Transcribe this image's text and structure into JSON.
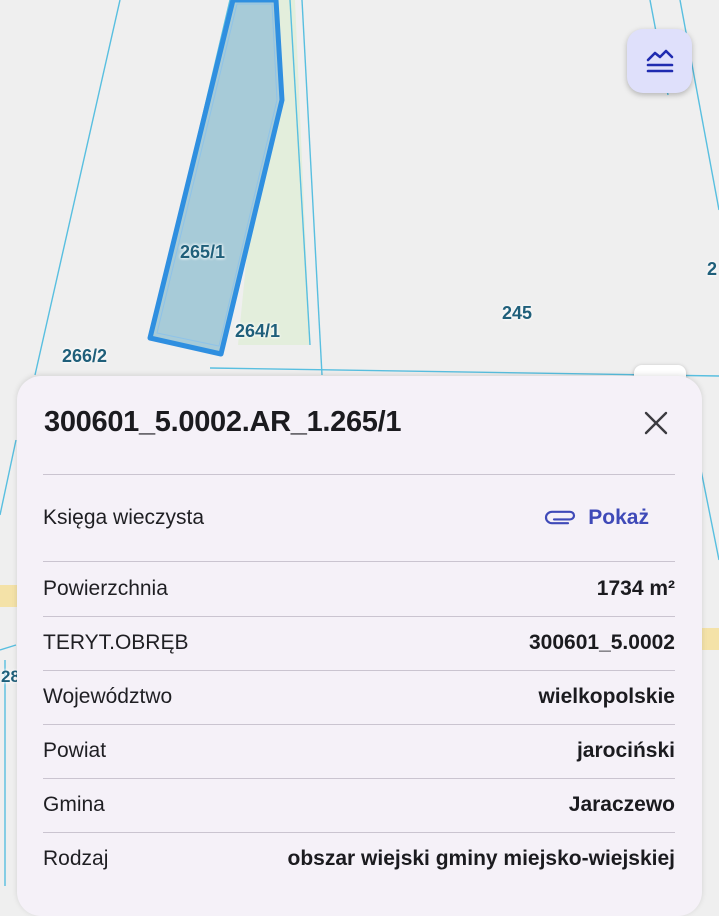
{
  "map": {
    "labels": [
      "265/1",
      "264/1",
      "245",
      "266/2",
      "2",
      "28"
    ]
  },
  "layers_button": {
    "icon": "layers-icon",
    "color": "#1f2bb0"
  },
  "panel": {
    "title": "300601_5.0002.AR_1.265/1",
    "close_icon": "close-icon",
    "kw": {
      "label": "Księga wieczysta",
      "link_label": "Pokaż",
      "icon": "paperclip-icon"
    },
    "rows": [
      {
        "label": "Powierzchnia",
        "value": "1734 m²"
      },
      {
        "label": "TERYT.OBRĘB",
        "value": "300601_5.0002"
      },
      {
        "label": "Województwo",
        "value": "wielkopolskie"
      },
      {
        "label": "Powiat",
        "value": "jarociński"
      },
      {
        "label": "Gmina",
        "value": "Jaraczewo"
      },
      {
        "label": "Rodzaj",
        "value": "obszar wiejski gminy miejsko-wiejskiej"
      }
    ]
  },
  "colors": {
    "parcel_outline": "#2f8fe0",
    "parcel_fill": "#a7cbd8",
    "link": "#3f4ab8"
  }
}
